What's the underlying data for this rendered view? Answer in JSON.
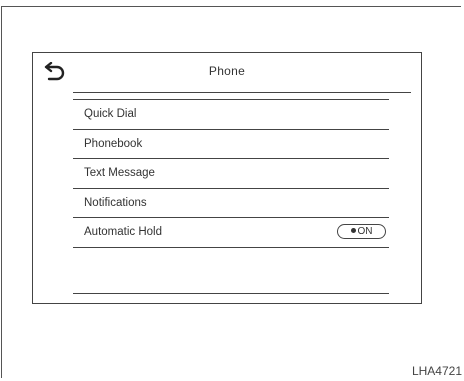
{
  "screen": {
    "title": "Phone",
    "back_icon": "back-arrow-icon",
    "menu_items": [
      {
        "label": "Quick Dial"
      },
      {
        "label": "Phonebook"
      },
      {
        "label": "Text Message"
      },
      {
        "label": "Notifications"
      },
      {
        "label": "Automatic Hold",
        "toggle": "ON",
        "toggle_state": true
      }
    ]
  },
  "figure_code": "LHA4721"
}
